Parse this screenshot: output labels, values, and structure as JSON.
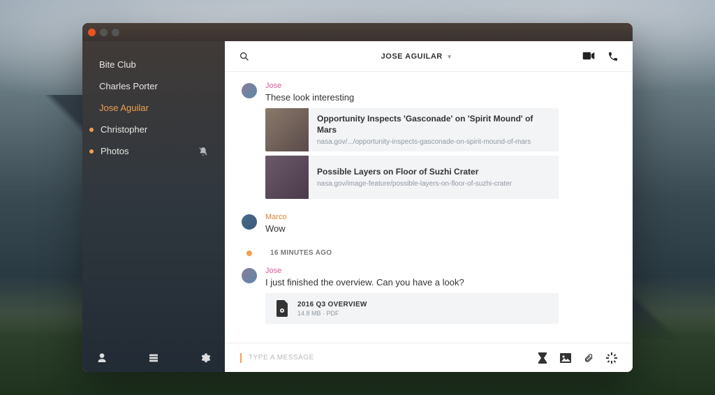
{
  "sidebar": {
    "conversations": [
      {
        "label": "Bite Club",
        "active": false,
        "unread": false,
        "muted": false
      },
      {
        "label": "Charles Porter",
        "active": false,
        "unread": false,
        "muted": false
      },
      {
        "label": "Jose Aguilar",
        "active": true,
        "unread": false,
        "muted": false
      },
      {
        "label": "Christopher",
        "active": false,
        "unread": true,
        "muted": false
      },
      {
        "label": "Photos",
        "active": false,
        "unread": true,
        "muted": true
      }
    ]
  },
  "header": {
    "title": "JOSE AGUILAR"
  },
  "messages": {
    "group1": {
      "author": "Jose",
      "text": "These look interesting",
      "links": [
        {
          "title": "Opportunity Inspects 'Gasconade' on 'Spirit Mound' of Mars",
          "url": "nasa.gov/.../opportunity-inspects-gasconade-on-spirit-mound-of-mars"
        },
        {
          "title": "Possible Layers on Floor of Suzhi Crater",
          "url": "nasa.gov/image-feature/possible-layers-on-floor-of-suzhi-crater"
        }
      ]
    },
    "group2": {
      "author": "Marco",
      "text": "Wow"
    },
    "timestamp": "16 MINUTES AGO",
    "group3": {
      "author": "Jose",
      "text": "I just finished the overview. Can you have a look?",
      "file": {
        "name": "2016 Q3 OVERVIEW",
        "meta": "14.8 MB  ·  PDF"
      }
    }
  },
  "composer": {
    "placeholder": "TYPE A MESSAGE"
  }
}
